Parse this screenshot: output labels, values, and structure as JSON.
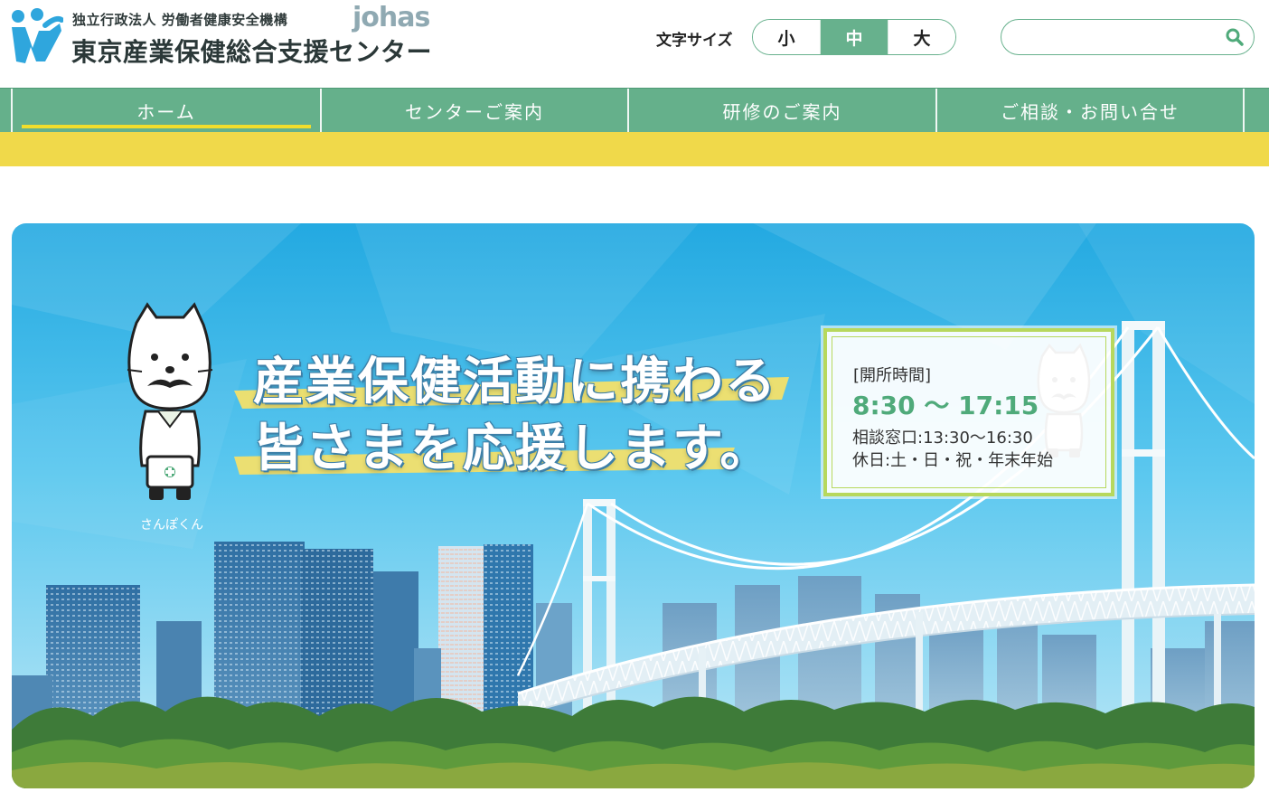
{
  "header": {
    "org_sub": "独立行政法人 労働者健康安全機構",
    "brand": "johas",
    "org_main": "東京産業保健総合支援センター"
  },
  "font_size": {
    "label": "文字サイズ",
    "options": [
      "小",
      "中",
      "大"
    ],
    "selected": "中"
  },
  "search": {
    "placeholder": "",
    "value": ""
  },
  "nav": {
    "items": [
      "ホーム",
      "センターご案内",
      "研修のご案内",
      "ご相談・お問い合せ"
    ],
    "active": "ホーム"
  },
  "banner": {
    "headline_1": "産業保健活動に携わる",
    "headline_2": "皆さまを応援します。",
    "mascot_name": "さんぽくん",
    "hours_label": "[開所時間]",
    "hours_time": "8:30 〜 17:15",
    "consult_hours": "相談窓口:13:30〜16:30",
    "holidays": "休日:土・日・祝・年末年始"
  },
  "colors": {
    "primary_green": "#65b08b",
    "accent_yellow": "#f0d94a",
    "sky_blue": "#3fb7e6"
  }
}
